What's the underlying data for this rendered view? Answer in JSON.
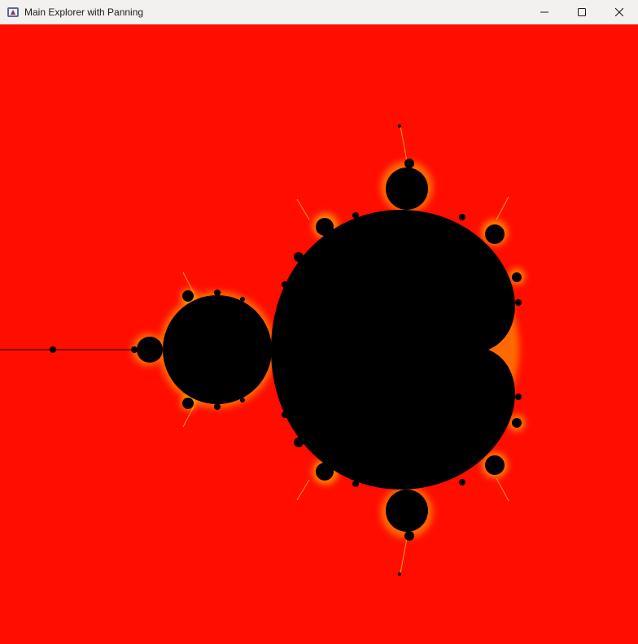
{
  "window": {
    "title": "Main Explorer with Panning",
    "icon": "java-coffee-cup-icon",
    "controls": [
      "minimize-icon",
      "maximize-icon",
      "close-icon"
    ]
  },
  "colors": {
    "titlebar": "#f3f1ef",
    "background": "#ff0e00",
    "set": "#000000",
    "edge_glow": "#ff9a00",
    "edge_highlight": "#ffe400"
  },
  "canvas": {
    "content": "mandelbrot-set-render"
  }
}
